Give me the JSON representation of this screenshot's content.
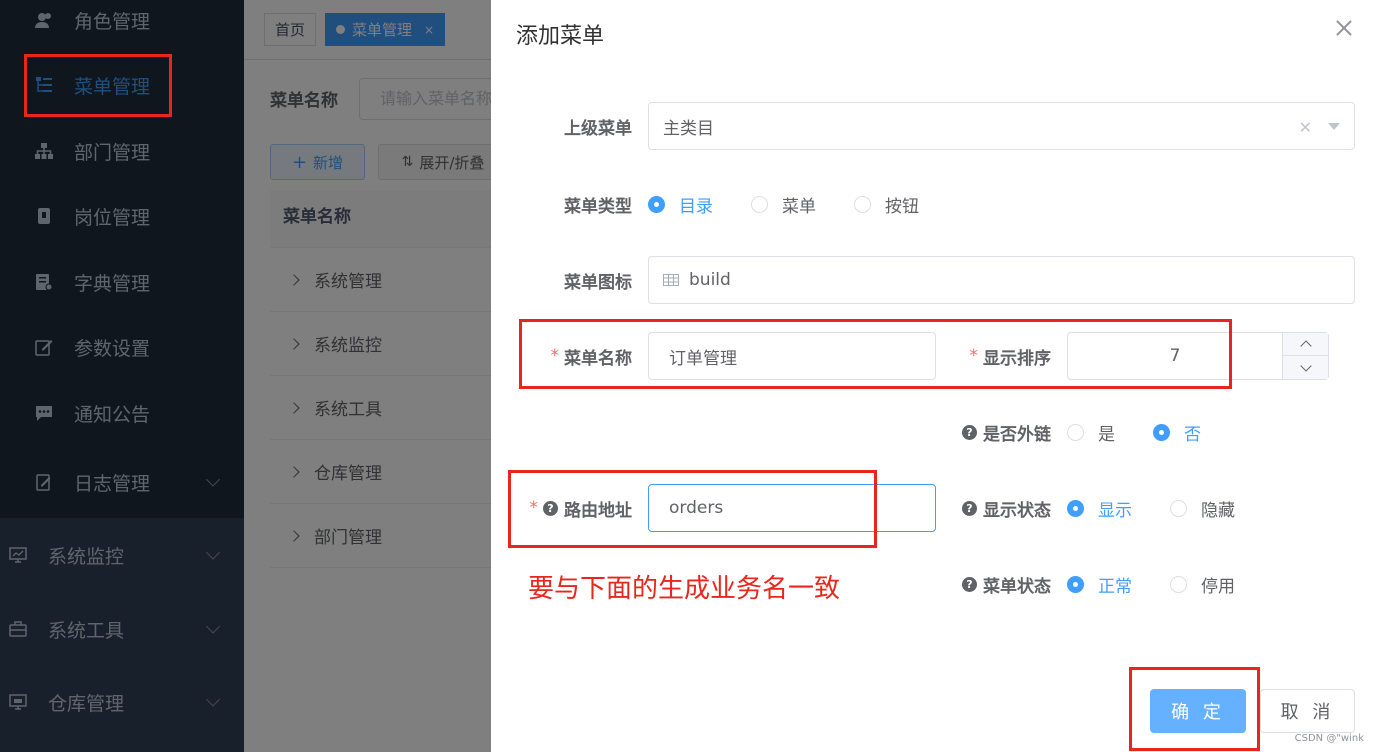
{
  "sidebar": {
    "items": [
      {
        "label": "角色管理",
        "icon": "user-icon"
      },
      {
        "label": "菜单管理",
        "icon": "tree-table-icon"
      },
      {
        "label": "部门管理",
        "icon": "tree-icon"
      },
      {
        "label": "岗位管理",
        "icon": "post-icon"
      },
      {
        "label": "字典管理",
        "icon": "dict-icon"
      },
      {
        "label": "参数设置",
        "icon": "edit-icon"
      },
      {
        "label": "通知公告",
        "icon": "message-icon"
      },
      {
        "label": "日志管理",
        "icon": "log-icon"
      }
    ],
    "groups": [
      {
        "label": "系统监控",
        "icon": "monitor-icon"
      },
      {
        "label": "系统工具",
        "icon": "tool-icon"
      },
      {
        "label": "仓库管理",
        "icon": "warehouse-icon"
      }
    ]
  },
  "tags": {
    "home": "首页",
    "current": "菜单管理",
    "close": "×"
  },
  "query": {
    "label": "菜单名称",
    "placeholder": "请输入菜单名称"
  },
  "toolbar": {
    "add": "新增",
    "expand": "展开/折叠"
  },
  "table": {
    "header": "菜单名称",
    "rows": [
      "系统管理",
      "系统监控",
      "系统工具",
      "仓库管理",
      "部门管理"
    ]
  },
  "dialog": {
    "title": "添加菜单",
    "parent": {
      "label": "上级菜单",
      "value": "主类目"
    },
    "type": {
      "label": "菜单类型",
      "options": [
        "目录",
        "菜单",
        "按钮"
      ],
      "selected": "目录"
    },
    "icon": {
      "label": "菜单图标",
      "value": "build"
    },
    "name": {
      "label": "菜单名称",
      "value": "订单管理"
    },
    "order": {
      "label": "显示排序",
      "value": "7"
    },
    "external": {
      "label": "是否外链",
      "options": [
        "是",
        "否"
      ],
      "selected": "否"
    },
    "path": {
      "label": "路由地址",
      "value": "orders"
    },
    "visible": {
      "label": "显示状态",
      "options": [
        "显示",
        "隐藏"
      ],
      "selected": "显示"
    },
    "status": {
      "label": "菜单状态",
      "options": [
        "正常",
        "停用"
      ],
      "selected": "正常"
    },
    "ok": "确 定",
    "cancel": "取 消"
  },
  "annotation": "要与下面的生成业务名一致",
  "watermark": "CSDN @\"wink",
  "colors": {
    "primary": "#409eff",
    "annotation": "#e8261c",
    "sidebar": "#1f2d3d"
  }
}
